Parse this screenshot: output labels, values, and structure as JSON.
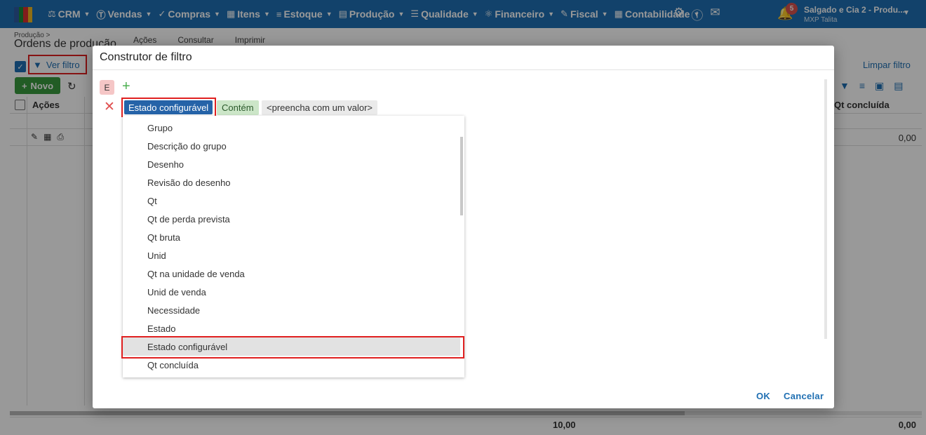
{
  "brand_colors": {
    "nav": "#1f6fb2",
    "accent": "#1f6fb2",
    "danger": "#e02020",
    "success": "#3a9a3e"
  },
  "logo_colors": [
    "#2d5aa0",
    "#1a8a3a",
    "#d93030",
    "#f0b820"
  ],
  "nav": {
    "items": [
      {
        "icon": "crm-icon",
        "label": "CRM"
      },
      {
        "icon": "dollar-icon",
        "label": "Vendas"
      },
      {
        "icon": "cart-icon",
        "label": "Compras"
      },
      {
        "icon": "items-icon",
        "label": "Itens"
      },
      {
        "icon": "stock-icon",
        "label": "Estoque"
      },
      {
        "icon": "chart-icon",
        "label": "Produção"
      },
      {
        "icon": "checklist-icon",
        "label": "Qualidade"
      },
      {
        "icon": "money-icon",
        "label": "Financeiro"
      },
      {
        "icon": "fiscal-icon",
        "label": "Fiscal"
      },
      {
        "icon": "calculator-icon",
        "label": "Contabilidade"
      }
    ],
    "notifications": "5",
    "company": "Salgado e Cia 2 - Produ...",
    "user": "MXP Talita"
  },
  "page": {
    "breadcrumb": "Produção >",
    "title": "Ordens de produção",
    "toolbar": [
      "Ações",
      "Consultar",
      "Imprimir"
    ],
    "ver_filtro": "Ver filtro",
    "limpar_filtro": "Limpar filtro",
    "novo": "Novo",
    "col_acoes": "Ações",
    "col_qt_concluida": "Qt concluída",
    "row_value": "0,00",
    "footer_total_1": "10,00",
    "footer_total_2": "0,00"
  },
  "modal": {
    "title": "Construtor de filtro",
    "group_operator": "E",
    "field": "Estado configurável",
    "operator": "Contém",
    "value_placeholder": "<preencha com um valor>",
    "field_options": [
      "Grupo",
      "Descrição do grupo",
      "Desenho",
      "Revisão do desenho",
      "Qt",
      "Qt de perda prevista",
      "Qt bruta",
      "Unid",
      "Qt na unidade de venda",
      "Unid de venda",
      "Necessidade",
      "Estado",
      "Estado configurável",
      "Qt concluída"
    ],
    "selected_option": "Estado configurável",
    "ok": "OK",
    "cancel": "Cancelar"
  }
}
